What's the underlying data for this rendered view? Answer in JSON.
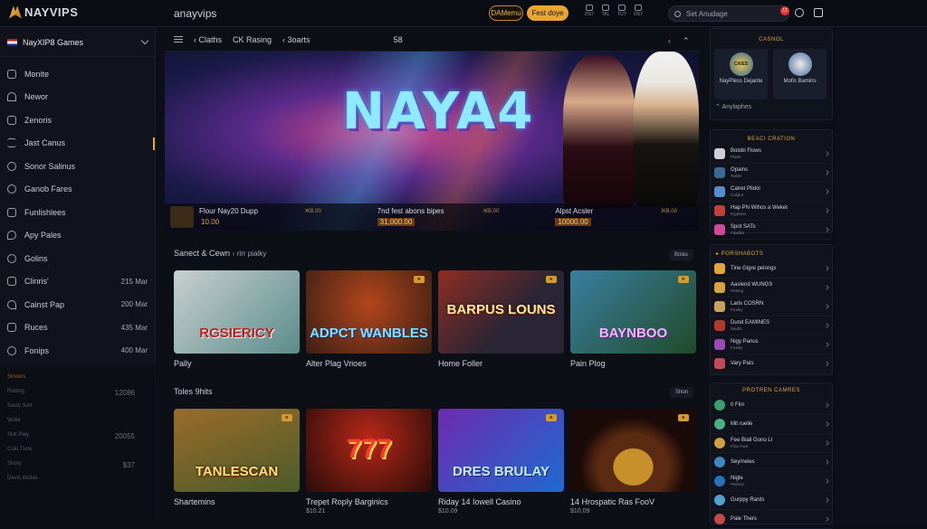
{
  "topbar": {
    "logo": "NAYVIPS",
    "site_name": "anayvips",
    "btn_outline": "DAMemu",
    "btn_primary": "Fest doye",
    "mini_icons": [
      "DS7",
      "TAL",
      "TUT",
      "DS7"
    ],
    "search_placeholder": "Set Anudage",
    "notif_count": "12"
  },
  "sidebar": {
    "header": "NayXIP8 Games",
    "items": [
      {
        "label": "Monite",
        "value": ""
      },
      {
        "label": "Newor",
        "value": ""
      },
      {
        "label": "Zenoris",
        "value": ""
      },
      {
        "label": "Jast Canus",
        "value": ""
      },
      {
        "label": "Sonor Salinus",
        "value": ""
      },
      {
        "label": "Ganob Fares",
        "value": ""
      },
      {
        "label": "Funlishlees",
        "value": ""
      },
      {
        "label": "Apy Pales",
        "value": ""
      },
      {
        "label": "Golins",
        "value": ""
      },
      {
        "label": "Clinris'",
        "value": "215 Mar"
      },
      {
        "label": "Cainst Pap",
        "value": "200 Mar"
      },
      {
        "label": "Ruces",
        "value": "435 Mar"
      },
      {
        "label": "Fonips",
        "value": "400 Mar"
      }
    ],
    "lower": {
      "heading": "Sinoers",
      "rows": [
        {
          "label": "Retting",
          "value": "12086"
        },
        {
          "label": "Sauly Sort",
          "value": ""
        },
        {
          "label": "Wolle",
          "value": ""
        },
        {
          "label": "Stot Play",
          "value": "20055"
        },
        {
          "label": "Colo Turie",
          "value": ""
        },
        {
          "label": "Shory",
          "value": "$37"
        },
        {
          "label": "Devis Wobie",
          "value": ""
        }
      ]
    }
  },
  "main": {
    "subnav": [
      "Claths",
      "CK Rasing",
      "3oarts",
      "58"
    ],
    "banner": {
      "title": "NAYA4",
      "items": [
        {
          "name": "Flour Nay20 Dupp",
          "price": "10.00",
          "tag": "ЖВ.00"
        },
        {
          "name": "7nd fest abons bipes",
          "price": "31,000.00",
          "tag": "ЖВ.00"
        },
        {
          "name": "Alpst Acsler",
          "price": "10000.00",
          "tag": "ЖВ.00"
        }
      ]
    },
    "section1": {
      "title": "Sanect & Cewn",
      "sub": "rirr pialky",
      "button": "Bolas",
      "cards": [
        {
          "caption": "Pally",
          "art": "RGSIERICY",
          "colors": [
            "#c8d0cf",
            "#5a8c8a"
          ]
        },
        {
          "caption": "Alter Plag Vrioes",
          "art": "ADPCT WANBLES",
          "colors": [
            "#3b1f14",
            "#b3461d"
          ]
        },
        {
          "caption": "Home Foller",
          "art": "BARPUS LOUNS",
          "colors": [
            "#2a2534",
            "#8f2d24"
          ]
        },
        {
          "caption": "Pain Plog",
          "art": "BAYNBOO",
          "colors": [
            "#214a2a",
            "#3a7fa0"
          ]
        }
      ]
    },
    "section2": {
      "title": "Toles 9hits",
      "button": "Shon",
      "cards": [
        {
          "caption": "Shartemins",
          "sub": "",
          "art": "TANLESCAN",
          "colors": [
            "#4a5c2a",
            "#9a6b2a"
          ]
        },
        {
          "caption": "Trepet Roply Barginics",
          "sub": "$10.21",
          "art": "777",
          "colors": [
            "#2a0c08",
            "#b8281a"
          ]
        },
        {
          "caption": "Riday 14 Iowell Casino",
          "sub": "$10.09",
          "art": "DRES BRULAY",
          "colors": [
            "#6b2bb0",
            "#1f6ad0"
          ]
        },
        {
          "caption": "14 Hrospatic Ras FooV",
          "sub": "$10.09",
          "art": "",
          "colors": [
            "#1a0a08",
            "#5a2a12"
          ]
        }
      ]
    }
  },
  "right": {
    "casino_head": "CASNOL",
    "promo": [
      {
        "label": "NayPless Dejante",
        "art": "CAIES"
      },
      {
        "label": "Mofis Bamins",
        "art": ""
      }
    ],
    "promo_foot": "Anylaphes",
    "creation_head": "BEACI CRATION",
    "creation": [
      {
        "t": "Bolobi Flows",
        "s": "Plade"
      },
      {
        "t": "Opains",
        "s": "Tatble"
      },
      {
        "t": "Catret Plidol",
        "s": "Calipor"
      },
      {
        "t": "Hap PN Wihos a Weket",
        "s": "Ryplians"
      },
      {
        "t": "Spot SATs",
        "s": "Fawilbs"
      }
    ],
    "shabots_head": "PORSHABOTS",
    "shabots": [
      {
        "t": "Tine Gigre pelongs",
        "s": ""
      },
      {
        "t": "Aaslend WUNGS",
        "s": "Petting"
      },
      {
        "t": "Laris COSRN",
        "s": "Frusky"
      },
      {
        "t": "Dund EAMINES",
        "s": "Saulfs"
      },
      {
        "t": "Nigy Panus",
        "s": "Frusky"
      },
      {
        "t": "Vary Pats",
        "s": ""
      }
    ],
    "protren_head": "PROTREN CAMRES",
    "protren": [
      {
        "t": "0 Flm",
        "s": ""
      },
      {
        "t": "Mit ruelle",
        "s": ""
      },
      {
        "t": "Fee Biall Gono Ll",
        "s": "Frac Fuel"
      },
      {
        "t": "Seyrneles",
        "s": ""
      },
      {
        "t": "Nigle",
        "s": "Pelhins"
      },
      {
        "t": "Gurppy Rards",
        "s": ""
      },
      {
        "t": "Pale Thers",
        "s": ""
      }
    ]
  }
}
